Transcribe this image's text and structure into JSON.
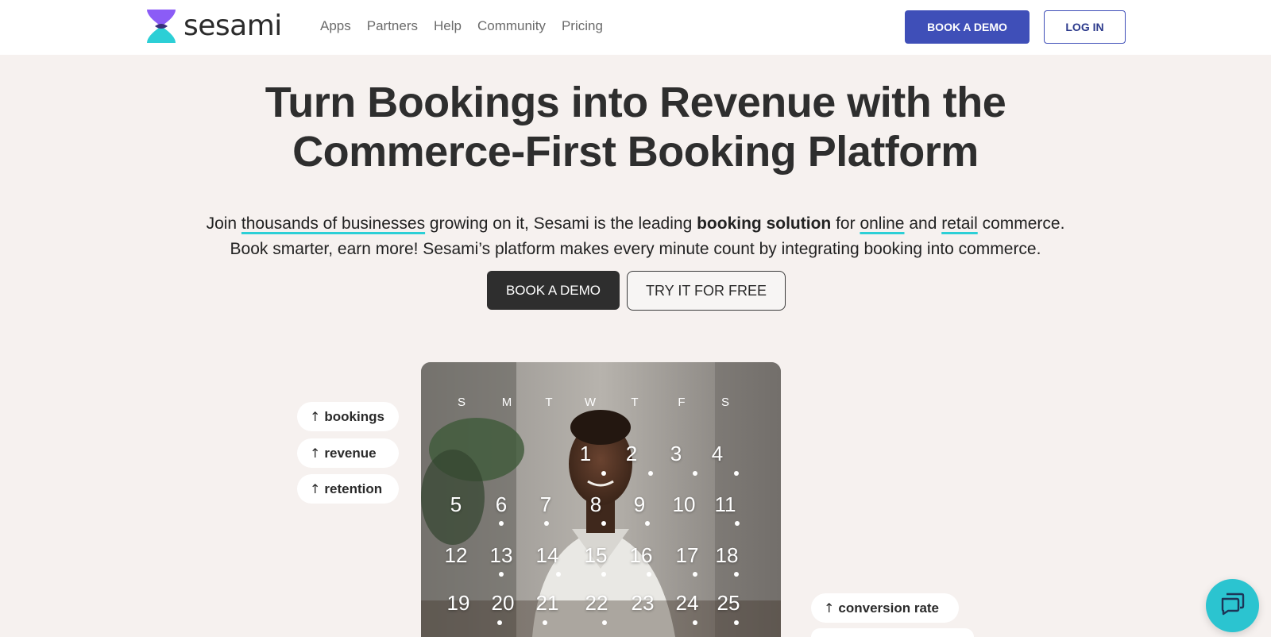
{
  "header": {
    "logo_text": "sesami",
    "nav": [
      "Apps",
      "Partners",
      "Help",
      "Community",
      "Pricing"
    ],
    "book_demo": "BOOK A DEMO",
    "login": "LOG IN"
  },
  "hero": {
    "title_line1": "Turn Bookings into Revenue with the",
    "title_line2": "Commerce-First Booking Platform",
    "sub": {
      "p1": "Join ",
      "link1": "thousands of businesses",
      "p2": " growing on it, Sesami is the leading ",
      "bold": "booking solution",
      "p3": " for ",
      "link2": "online",
      "p4": " and ",
      "link3": "retail",
      "p5": " commerce.",
      "line2": "Book smarter, earn more! Sesami’s platform makes every minute count by integrating booking into commerce."
    },
    "book_demo": "BOOK A DEMO",
    "try_free": "TRY IT FOR FREE"
  },
  "pills": {
    "bookings": "bookings",
    "revenue": "revenue",
    "retention": "retention",
    "conversion": "conversion rate"
  },
  "calendar": {
    "days_of_week": [
      "S",
      "M",
      "T",
      "W",
      "T",
      "F",
      "S"
    ],
    "week1": [
      "1",
      "2",
      "3",
      "4"
    ],
    "week2": [
      "5",
      "6",
      "7",
      "8",
      "9",
      "10",
      "11"
    ],
    "week3": [
      "12",
      "13",
      "14",
      "15",
      "16",
      "17",
      "18"
    ],
    "week4": [
      "19",
      "20",
      "21",
      "22",
      "23",
      "24",
      "25"
    ]
  },
  "icons": {
    "arrow": "arrow-up-icon",
    "chat": "chat-bubble-icon"
  },
  "colors": {
    "brand_purple": "#8b5cf6",
    "brand_cyan": "#2ccfd6",
    "primary_button": "#3f4fb8",
    "dark_button": "#2e2e2e",
    "background": "#f6f1ef"
  }
}
